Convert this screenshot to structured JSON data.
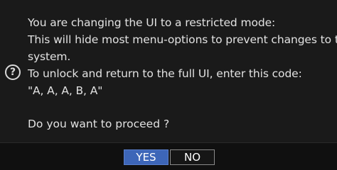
{
  "dialog": {
    "message_lines": [
      "You are changing the UI to a restricted mode:",
      "This will hide most menu-options to prevent changes to the",
      "system.",
      "To unlock and return to the full UI, enter this code:",
      "\"A, A, A, B, A\""
    ],
    "question": "Do you want to proceed ?",
    "help_icon_glyph": "?",
    "icon": "help-question-icon",
    "buttons": {
      "yes_label": "YES",
      "no_label": "NO"
    },
    "colors": {
      "background": "#1a1a1a",
      "text": "#e2e2e2",
      "yes_button": "#3d66b8",
      "no_button_border": "#8a8a8a"
    }
  }
}
